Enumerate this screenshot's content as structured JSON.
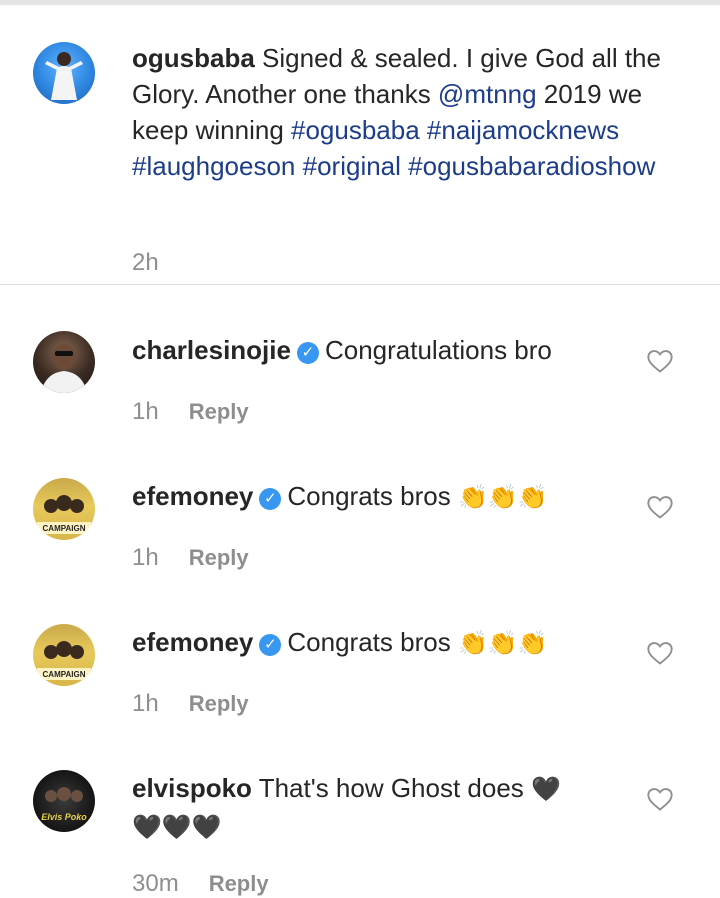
{
  "caption": {
    "username": "ogusbaba",
    "text_1": "Signed & sealed. I give God all the Glory. Another one thanks ",
    "mention": "@mtnng",
    "text_2": " 2019 we keep winning ",
    "hashtags": [
      "#ogusbaba",
      "#naijamocknews",
      "#laughgoeson",
      "#original",
      "#ogusbabaradioshow"
    ],
    "time": "2h"
  },
  "comments": [
    {
      "username": "charlesinojie",
      "verified": true,
      "text": "Congratulations bro",
      "emoji": "",
      "time": "1h",
      "reply": "Reply"
    },
    {
      "username": "efemoney",
      "verified": true,
      "text": "Congrats bros",
      "emoji": "👏👏👏",
      "time": "1h",
      "reply": "Reply"
    },
    {
      "username": "efemoney",
      "verified": true,
      "text": "Congrats bros",
      "emoji": "👏👏👏",
      "time": "1h",
      "reply": "Reply"
    },
    {
      "username": "elvispoko",
      "verified": false,
      "text": "That's how Ghost does",
      "emoji": "🖤",
      "emoji_line2": "🖤🖤🖤",
      "time": "30m",
      "reply": "Reply"
    }
  ],
  "avatar_labels": {
    "efemoney": "CAMPAIGN",
    "elvispoko": "Elvis Poko"
  },
  "colors": {
    "link": "#1d3d8a",
    "verified": "#3897f0",
    "meta": "#8e8e8e"
  },
  "icons": {
    "verified": "verified-badge-icon",
    "like": "heart-outline-icon"
  }
}
